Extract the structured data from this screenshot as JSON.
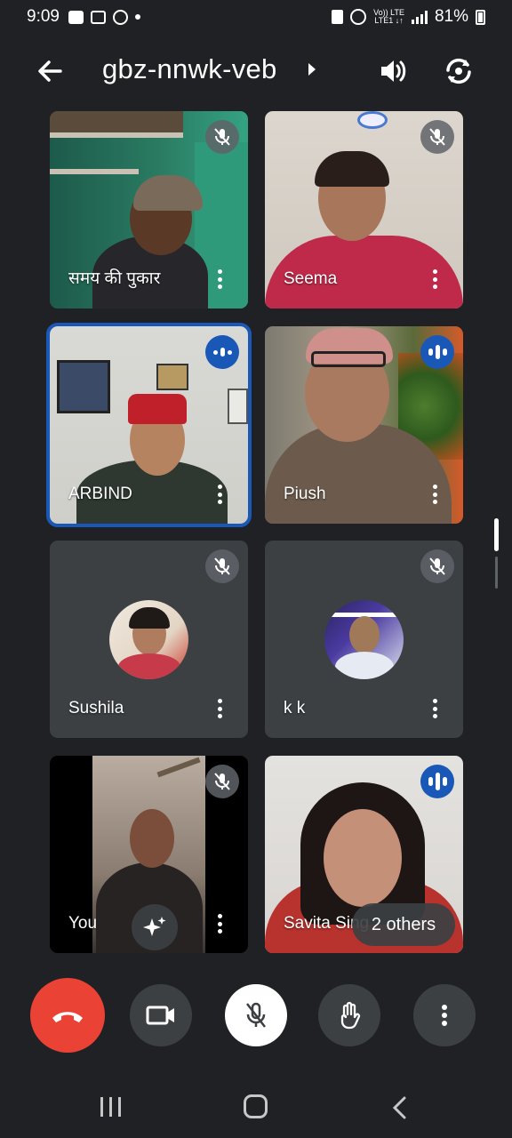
{
  "status_bar": {
    "time": "9:09",
    "network_top": "Vo)) LTE",
    "network_bottom": "LTE1 ↓↑",
    "battery": "81%"
  },
  "header": {
    "meeting_code": "gbz-nnwk-veb",
    "icons": [
      "back-arrow-icon",
      "caret-right-icon",
      "speaker-icon",
      "switch-camera-icon"
    ]
  },
  "participants": [
    {
      "name": "समय की पुकार",
      "state": "muted",
      "video": "on"
    },
    {
      "name": "Seema",
      "state": "muted",
      "video": "on"
    },
    {
      "name": "ARBIND",
      "state": "speaking",
      "video": "on",
      "active": true
    },
    {
      "name": "Piush",
      "state": "speaking",
      "video": "on"
    },
    {
      "name": "Sushila",
      "state": "muted",
      "video": "off"
    },
    {
      "name": "k k",
      "state": "muted",
      "video": "off"
    },
    {
      "name": "You",
      "state": "muted",
      "video": "on"
    },
    {
      "name": "Savita Sing",
      "state": "speaking",
      "video": "on"
    }
  ],
  "others_pill": "2 others",
  "controls": {
    "buttons": [
      "end-call-button",
      "camera-button",
      "mic-button",
      "raise-hand-button",
      "more-options-button"
    ],
    "colors": {
      "end_call": "#ea4335",
      "speaking_badge": "#1a58b8",
      "mic_bg": "#ffffff"
    }
  },
  "nav_bar": {
    "icons": [
      "recents-icon",
      "home-icon",
      "back-icon"
    ]
  }
}
